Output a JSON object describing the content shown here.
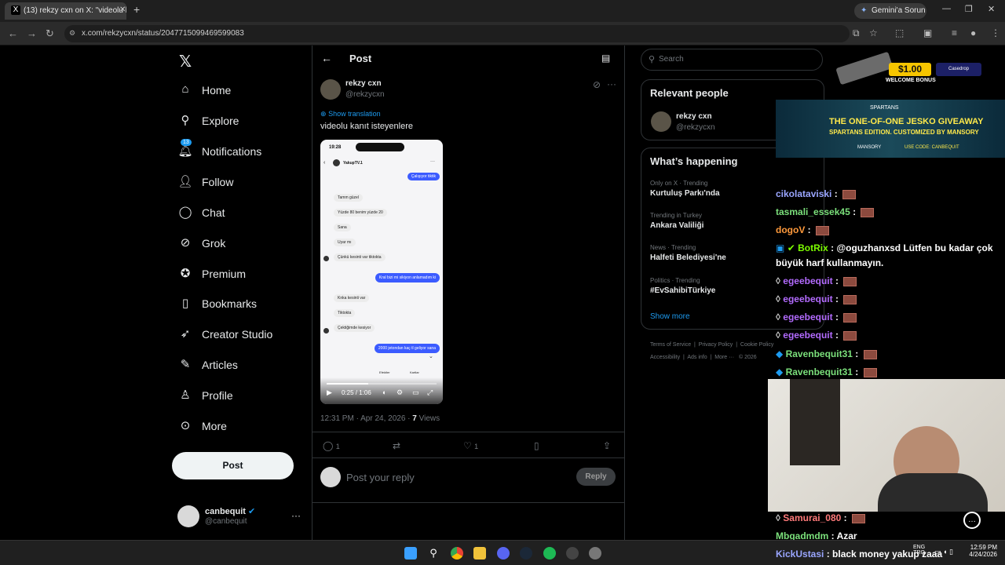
{
  "browser": {
    "tab_title": "(13) rekzy cxn on X: \"videolu ka...",
    "tab_favicon": "X",
    "url": "x.com/rekzycxn/status/2047715099469599083",
    "gemini_label": "Gemini'a Sorun"
  },
  "nav": {
    "items": [
      {
        "label": "Home",
        "icon": "home-icon"
      },
      {
        "label": "Explore",
        "icon": "search-icon"
      },
      {
        "label": "Notifications",
        "icon": "bell-icon",
        "badge": "13"
      },
      {
        "label": "Follow",
        "icon": "person-plus-icon"
      },
      {
        "label": "Chat",
        "icon": "chat-icon"
      },
      {
        "label": "Grok",
        "icon": "grok-icon"
      },
      {
        "label": "Premium",
        "icon": "verified-icon"
      },
      {
        "label": "Bookmarks",
        "icon": "bookmark-icon"
      },
      {
        "label": "Creator Studio",
        "icon": "rocket-icon"
      },
      {
        "label": "Articles",
        "icon": "article-icon"
      },
      {
        "label": "Profile",
        "icon": "person-icon"
      },
      {
        "label": "More",
        "icon": "more-circle-icon"
      }
    ],
    "post_button": "Post",
    "account_name": "canbequit",
    "account_handle": "@canbequit"
  },
  "post": {
    "header_title": "Post",
    "author_name": "rekzy cxn",
    "author_handle": "@rekzycxn",
    "show_translation": "Show translation",
    "text": "videolu kanıt isteyenlere",
    "timestamp": "12:31 PM · Apr 24, 2026 · ",
    "views_count": "7",
    "views_label": " Views",
    "replies": "1",
    "likes": "1",
    "reply_placeholder": "Post your reply",
    "reply_button": "Reply",
    "video": {
      "status_time": "19:28",
      "contact": "YakupTV.1",
      "progress": "0:25 / 1:06",
      "progress_fraction": 0.38,
      "messages": [
        {
          "text": "Çalışıyor tiktik",
          "out": true
        },
        {
          "text": "Tamm güzel",
          "out": false
        },
        {
          "text": "Yüzde 80 benim yüzde 20",
          "out": false
        },
        {
          "text": "Sana",
          "out": false
        },
        {
          "text": "Uyar mı",
          "out": false
        },
        {
          "text": "Çünkü kesinti var tiktokta",
          "out": false
        },
        {
          "text": "Kral bizi mi sikiyon anlamadım ki",
          "out": true
        },
        {
          "text": "Knka kesinti var",
          "out": false
        },
        {
          "text": "Tiktokta",
          "out": false
        },
        {
          "text": "Çektiğimde kesiyor",
          "out": false
        },
        {
          "text": "2000 jetondan kaç tl geliyor sana",
          "out": true
        }
      ],
      "bottom_labels": [
        "Efektler",
        "Kartlar"
      ]
    }
  },
  "sidebar": {
    "search_placeholder": "Search",
    "relevant_title": "Relevant people",
    "relevant_name": "rekzy cxn",
    "relevant_handle": "@rekzycxn",
    "happening_title": "What’s happening",
    "trends": [
      {
        "context": "Only on X · Trending",
        "name": "Kurtuluş Parkı'nda"
      },
      {
        "context": "Trending in Turkey",
        "name": "Ankara Valiliği"
      },
      {
        "context": "News · Trending",
        "name": "Halfeti Belediyesi'ne"
      },
      {
        "context": "Politics · Trending",
        "name": "#EvSahibiTürkiye"
      }
    ],
    "show_more": "Show more",
    "footer_line1": [
      "Terms of Service",
      "Privacy Policy",
      "Cookie Policy"
    ],
    "footer_line2": [
      "Accessibility",
      "Ads info",
      "More ···",
      "© 2026"
    ]
  },
  "overlay": {
    "bonus_amount": "$1.00",
    "bonus_text": "WELCOME BONUS",
    "bonus_brand": "Casedrop",
    "spartans_brand": "SPARTANS",
    "giveaway_title": "THE ONE-OF-ONE JESKO GIVEAWAY",
    "giveaway_sub": "SPARTANS EDITION. CUSTOMIZED BY MANSORY",
    "giveaway_brand": "MANSORY",
    "giveaway_code": "USE CODE: CANBEQUIT",
    "chat": [
      {
        "user": "cikolataviski",
        "color": "#9aa6ff",
        "msg": "",
        "emote": true
      },
      {
        "user": "tasmali_essek45",
        "color": "#7be07b",
        "msg": "",
        "emote": true
      },
      {
        "user": "dogoV",
        "color": "#ff9a3c",
        "msg": "",
        "emote": true
      },
      {
        "user": "BotRix",
        "color": "#7cfc00",
        "msg": "@oguzhanxsd Lütfen bu kadar çok",
        "emote": false
      },
      {
        "user": "",
        "color": "#ffffff",
        "msg": "büyük harf kullanmayın.",
        "emote": false
      },
      {
        "user": "egeebequit",
        "color": "#b36bff",
        "msg": "",
        "emote": true
      },
      {
        "user": "egeebequit",
        "color": "#b36bff",
        "msg": "",
        "emote": true
      },
      {
        "user": "egeebequit",
        "color": "#b36bff",
        "msg": "",
        "emote": true
      },
      {
        "user": "egeebequit",
        "color": "#b36bff",
        "msg": "",
        "emote": true
      },
      {
        "user": "Ravenbequit31",
        "color": "#7be07b",
        "msg": "",
        "emote": true
      },
      {
        "user": "Ravenbequit31",
        "color": "#7be07b",
        "msg": "",
        "emote": true
      },
      {
        "user": "Samurai_080",
        "color": "#ff7a7a",
        "msg": "",
        "emote": true
      },
      {
        "user": "Mbgadmdm",
        "color": "#7be07b",
        "msg": "Azar",
        "emote": false
      },
      {
        "user": "KickUstasi",
        "color": "#9aa6ff",
        "msg": "black money yakup zaaa",
        "emote": false
      }
    ]
  },
  "taskbar": {
    "lang": "ENG",
    "lang_sub": "TRQ",
    "time": "12:59 PM",
    "date": "4/24/2026"
  },
  "colors": {
    "accent": "#1d9bf0",
    "message_out": "#3b5bff",
    "message_in": "#f1f1f1"
  }
}
